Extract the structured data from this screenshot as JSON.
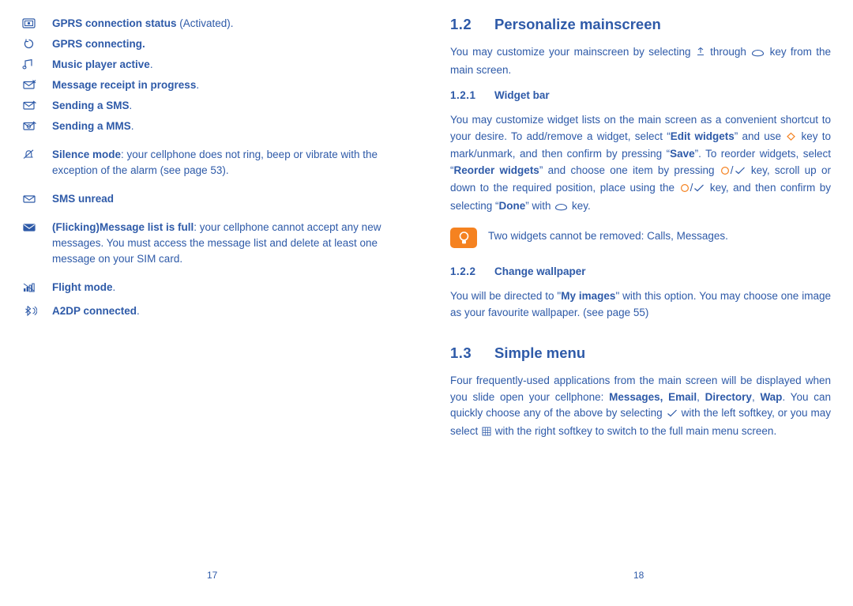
{
  "left_page": {
    "page_number": "17",
    "status_items": [
      {
        "icon": "gprs-connection-status-icon",
        "bold": "GPRS connection status",
        "plain": " (Activated)."
      },
      {
        "icon": "gprs-connecting-icon",
        "bold": "GPRS connecting.",
        "plain": ""
      },
      {
        "icon": "music-player-active-icon",
        "bold": "Music player active",
        "plain": "."
      },
      {
        "icon": "message-receipt-in-progress-icon",
        "bold": "Message receipt in progress",
        "plain": "."
      },
      {
        "icon": "sending-sms-icon",
        "bold": "Sending a SMS",
        "plain": "."
      },
      {
        "icon": "sending-mms-icon",
        "bold": "Sending a MMS",
        "plain": "."
      },
      {
        "icon": "silence-mode-icon",
        "bold": "Silence mode",
        "plain": ": your cellphone does not ring, beep or vibrate with the exception of the alarm (see page 53)."
      },
      {
        "icon": "sms-unread-icon",
        "bold": "SMS unread",
        "plain": ""
      },
      {
        "icon": "message-list-full-icon",
        "bold": "(Flicking)Message list is full",
        "plain": ": your cellphone cannot accept any new messages. You must access the message list and delete at least one message on your SIM card."
      },
      {
        "icon": "flight-mode-icon",
        "bold": "Flight mode",
        "plain": "."
      },
      {
        "icon": "a2dp-connected-icon",
        "bold": "A2DP connected",
        "plain": "."
      }
    ]
  },
  "right_page": {
    "page_number": "18",
    "section_1_2": {
      "number": "1.2",
      "title": "Personalize mainscreen",
      "intro_a": "You may customize your mainscreen by selecting ",
      "intro_b": " through ",
      "intro_c": " key from the main screen."
    },
    "section_1_2_1": {
      "number": "1.2.1",
      "title": "Widget bar",
      "p1_a": "You may customize widget lists on the main screen as a convenient shortcut to your desire. To add/remove a widget, select “",
      "p1_edit": "Edit widgets",
      "p1_b": "” and use ",
      "p1_c": " key to mark/unmark, and then confirm by pressing “",
      "p1_save": "Save",
      "p1_d": "”. To reorder widgets, select “",
      "p1_reorder": "Reorder widgets",
      "p1_e": "” and choose one item by pressing ",
      "p1_f": " key, scroll up or down to the required position, place using the ",
      "p1_g": " key, and then confirm by selecting “",
      "p1_done": "Done",
      "p1_h": "” with ",
      "p1_i": " key.",
      "note": "Two widgets cannot be removed: Calls, Messages."
    },
    "section_1_2_2": {
      "number": "1.2.2",
      "title": "Change wallpaper",
      "p1": "You will be directed to \"My images\" with this option. You may choose one image as your favourite wallpaper. (see page 55)",
      "p1_a": "You will be directed to \"",
      "p1_myimages": "My images",
      "p1_b": "\" with this option. You may choose one image as your favourite wallpaper. (see page 55)"
    },
    "section_1_3": {
      "number": "1.3",
      "title": "Simple menu",
      "p1_a": "Four frequently-used applications from the main screen will be displayed when you slide open your cellphone: ",
      "p1_messages": "Messages, Email",
      "p1_sep1": ", ",
      "p1_directory": "Directory",
      "p1_sep2": ", ",
      "p1_wap": "Wap",
      "p1_b": ". You can quickly choose any of the above by selecting ",
      "p1_c": " with the left softkey, or you may select ",
      "p1_d": " with the right softkey to switch to the full main menu screen."
    }
  },
  "colors": {
    "text_blue": "#2e5aa8",
    "note_orange": "#f58220"
  }
}
